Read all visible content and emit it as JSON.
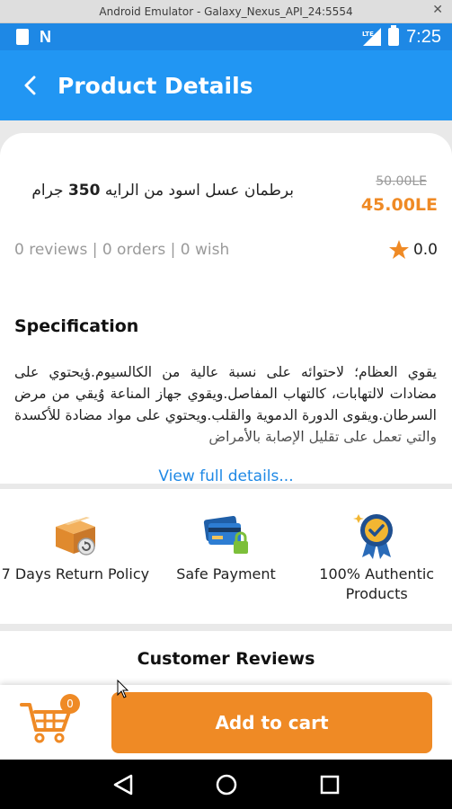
{
  "window": {
    "title": "Android Emulator - Galaxy_Nexus_API_24:5554",
    "close_label": "✕"
  },
  "status_bar": {
    "time": "7:25",
    "network": "LTE"
  },
  "app_bar": {
    "title": "Product Details"
  },
  "product": {
    "name_prefix": "برطمان عسل اسود من الرايه ",
    "name_bold": "350",
    "name_suffix": " جرام",
    "old_price": "50.00LE",
    "new_price": "45.00LE",
    "stats": "0 reviews | 0 orders | 0 wish",
    "rating": "0.0"
  },
  "specification": {
    "title": "Specification",
    "text": "يقوي العظام؛ لاحتوائه على نسبة عالية من الكالسيوم.ؤيحتوي على مضادات لالتهابات، كالتهاب المفاصل.ويقوي جهاز المناعة وُيقي من مرض السرطان.ويقوى الدورة الدموية والقلب.ويحتوي على مواد مضادة للأكسدة والتي تعمل على تقليل الإصابة بالأمراض",
    "view_full": "View full details..."
  },
  "features": [
    {
      "icon": "box-return-icon",
      "label": "7 Days Return Policy"
    },
    {
      "icon": "card-lock-icon",
      "label": "Safe Payment"
    },
    {
      "icon": "badge-ribbon-icon",
      "label": "100% Authentic Products"
    }
  ],
  "reviews": {
    "title": "Customer Reviews"
  },
  "cart": {
    "count": "0",
    "add_label": "Add to cart"
  },
  "colors": {
    "primary": "#2196f3",
    "accent": "#ef8a25",
    "link": "#1e88e5"
  }
}
